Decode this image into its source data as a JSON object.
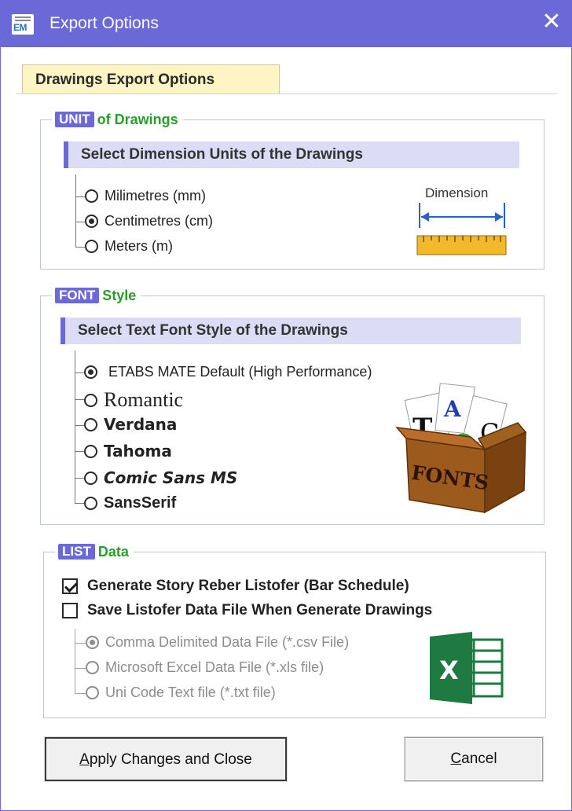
{
  "window": {
    "title": "Export Options",
    "icon_text": "EM"
  },
  "tab": {
    "label": "Drawings Export Options"
  },
  "unit_group": {
    "legend_tag": "UNIT",
    "legend_rest": "of Drawings",
    "header": "Select Dimension Units of the Drawings",
    "options": [
      {
        "label": "Milimetres (mm)",
        "checked": false
      },
      {
        "label": "Centimetres (cm)",
        "checked": true
      },
      {
        "label": "Meters (m)",
        "checked": false
      }
    ],
    "illustration_label": "Dimension"
  },
  "font_group": {
    "legend_tag": "FONT",
    "legend_rest": "Style",
    "header": "Select Text Font Style of the Drawings",
    "options": [
      {
        "label": "ETABS MATE Default (High Performance)",
        "checked": true
      },
      {
        "label": "Romantic",
        "checked": false
      },
      {
        "label": "Verdana",
        "checked": false
      },
      {
        "label": "Tahoma",
        "checked": false
      },
      {
        "label": "Comic Sans MS",
        "checked": false
      },
      {
        "label": "SansSerif",
        "checked": false
      }
    ],
    "illustration_label": "FONTS"
  },
  "list_group": {
    "legend_tag": "LIST",
    "legend_rest": "Data",
    "checkboxes": [
      {
        "label": "Generate Story Reber Listofer (Bar Schedule)",
        "checked": true
      },
      {
        "label": "Save Listofer Data File When Generate Drawings",
        "checked": false
      }
    ],
    "file_options": [
      {
        "label": "Comma Delimited Data File (*.csv File)",
        "checked": true
      },
      {
        "label": "Microsoft Excel Data File (*.xls file)",
        "checked": false
      },
      {
        "label": "Uni Code Text file (*.txt file)",
        "checked": false
      }
    ]
  },
  "buttons": {
    "apply_prefix": "A",
    "apply_rest": "pply Changes and Close",
    "cancel_prefix": "C",
    "cancel_rest": "ancel"
  },
  "colors": {
    "titlebar": "#6b68d8",
    "tab_background": "#fdf5c4",
    "legend_green": "#2a9d2a",
    "header_bar": "#dcdcf6"
  }
}
